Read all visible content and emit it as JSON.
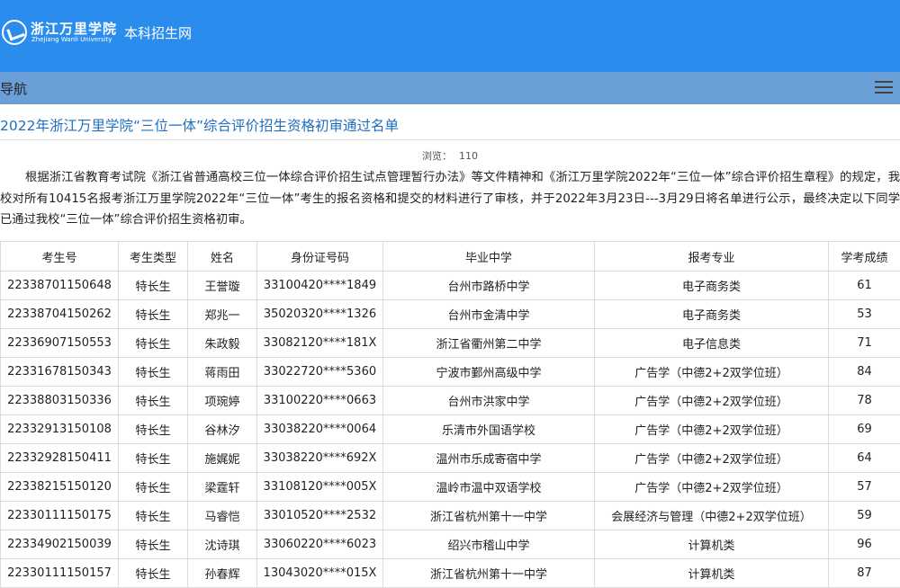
{
  "header": {
    "logo_cn": "浙江万里学院",
    "logo_en": "Zhejiang Wanli University",
    "site_name": "本科招生网"
  },
  "nav": {
    "title": "导航"
  },
  "article": {
    "title": "2022年浙江万里学院“三位一体”综合评价招生资格初审通过名单",
    "views_label": "浏览：",
    "views_count": "110",
    "intro": "根据浙江省教育考试院《浙江省普通高校三位一体综合评价招生试点管理暂行办法》等文件精神和《浙江万里学院2022年“三位一体”综合评价招生章程》的规定，我校对所有10415名报考浙江万里学院2022年“三位一体”考生的报名资格和提交的材料进行了审核，并于2022年3月23日---3月29日将名单进行公示，最终决定以下同学已通过我校“三位一体”综合评价招生资格初审。"
  },
  "table": {
    "headers": [
      "考生号",
      "考生类型",
      "姓名",
      "身份证号码",
      "毕业中学",
      "报考专业",
      "学考成绩"
    ],
    "rows": [
      [
        "22338701150648",
        "特长生",
        "王誉璇",
        "33100420****1849",
        "台州市路桥中学",
        "电子商务类",
        "61"
      ],
      [
        "22338704150262",
        "特长生",
        "郑兆一",
        "35020320****1326",
        "台州市金清中学",
        "电子商务类",
        "53"
      ],
      [
        "22336907150553",
        "特长生",
        "朱政毅",
        "33082120****181X",
        "浙江省衢州第二中学",
        "电子信息类",
        "71"
      ],
      [
        "22331678150343",
        "特长生",
        "蒋雨田",
        "33022720****5360",
        "宁波市鄞州高级中学",
        "广告学（中德2+2双学位班）",
        "84"
      ],
      [
        "22338803150336",
        "特长生",
        "项琬婷",
        "33100220****0663",
        "台州市洪家中学",
        "广告学（中德2+2双学位班）",
        "78"
      ],
      [
        "22332913150108",
        "特长生",
        "谷林汐",
        "33038220****0064",
        "乐清市外国语学校",
        "广告学（中德2+2双学位班）",
        "69"
      ],
      [
        "22332928150411",
        "特长生",
        "施娓妮",
        "33038220****692X",
        "温州市乐成寄宿中学",
        "广告学（中德2+2双学位班）",
        "64"
      ],
      [
        "22338215150120",
        "特长生",
        "梁霆轩",
        "33108120****005X",
        "温岭市温中双语学校",
        "广告学（中德2+2双学位班）",
        "57"
      ],
      [
        "22330111150175",
        "特长生",
        "马睿恺",
        "33010520****2532",
        "浙江省杭州第十一中学",
        "会展经济与管理（中德2+2双学位班）",
        "59"
      ],
      [
        "22334902150039",
        "特长生",
        "沈诗琪",
        "33060220****6023",
        "绍兴市稽山中学",
        "计算机类",
        "96"
      ],
      [
        "22330111150157",
        "特长生",
        "孙春辉",
        "13043020****015X",
        "浙江省杭州第十一中学",
        "计算机类",
        "87"
      ]
    ]
  },
  "colors": {
    "header_bg": "#2a8ded",
    "nav_bg": "#6a9fd7",
    "title_link": "#1f6fc0"
  },
  "icons": {
    "menu": "menu-icon",
    "logo": "logo-emblem-icon"
  }
}
